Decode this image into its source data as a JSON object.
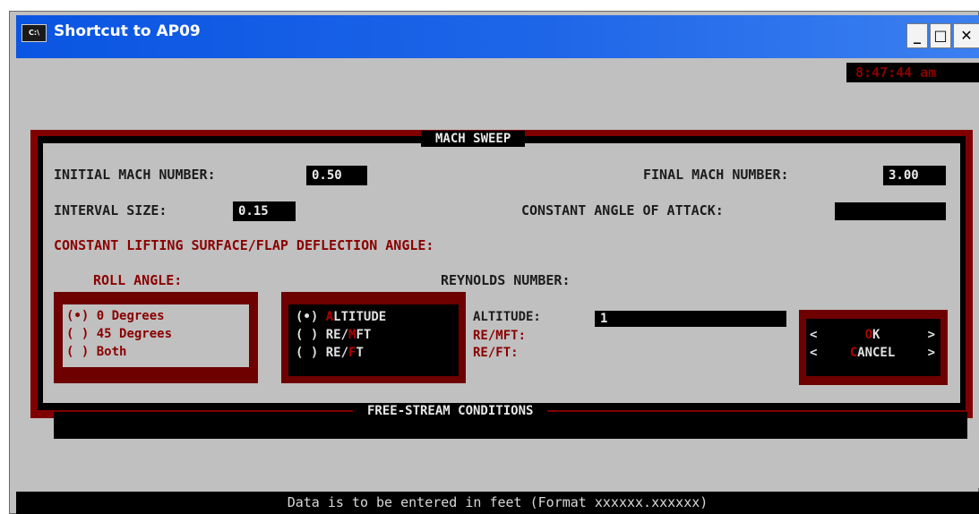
{
  "window": {
    "title": "Shortcut to AP09",
    "icon_label": "C:\\",
    "minimize": "_",
    "maximize": "□",
    "close": "✕"
  },
  "console": {
    "clock": "8:47:44 am"
  },
  "dialog": {
    "title": "MACH SWEEP",
    "initial_mach_label": "INITIAL MACH NUMBER:",
    "initial_mach_value": "0.50",
    "final_mach_label": "FINAL MACH NUMBER:",
    "final_mach_value": "3.00",
    "interval_label": "INTERVAL SIZE:",
    "interval_value": "0.15",
    "angle_attack_label": "CONSTANT ANGLE OF ATTACK:",
    "angle_attack_value": "",
    "deflection_label": "CONSTANT LIFTING SURFACE/FLAP DEFLECTION ANGLE:",
    "roll": {
      "label": "ROLL ANGLE:",
      "options": [
        {
          "mark": "(•)",
          "text": "0 Degrees",
          "selected": true
        },
        {
          "mark": "( )",
          "text": "45 Degrees",
          "selected": false
        },
        {
          "mark": "( )",
          "text": "Both",
          "selected": false
        }
      ]
    },
    "reynolds": {
      "label": "REYNOLDS NUMBER:",
      "options": [
        {
          "mark": "(•)",
          "hotkey": "A",
          "rest": "LTITUDE",
          "selected": true
        },
        {
          "mark": "( )",
          "pre": "RE/",
          "hotkey": "M",
          "rest": "FT",
          "selected": false
        },
        {
          "mark": "( )",
          "pre": "RE/",
          "hotkey": "F",
          "rest": "T",
          "selected": false
        }
      ],
      "altitude_label": "ALTITUDE:",
      "altitude_value": "1",
      "re_mft_label": "RE/MFT:",
      "re_ft_label": "RE/FT:"
    },
    "buttons": {
      "ok_left": "<",
      "ok_hotkey": "O",
      "ok_rest": "K",
      "ok_right": ">",
      "cancel_left": "<",
      "cancel_hotkey": "C",
      "cancel_rest": "ANCEL",
      "cancel_right": ">"
    }
  },
  "free_stream": {
    "title": "FREE-STREAM CONDITIONS"
  },
  "status": {
    "text": "Data is to be entered in feet (Format xxxxxx.xxxxxx)"
  }
}
